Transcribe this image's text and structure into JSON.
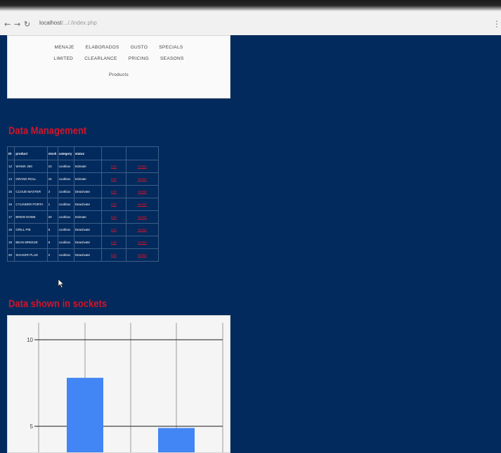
{
  "browser": {
    "back": "←",
    "forward": "→",
    "reload": "↻",
    "url_host": "localhost",
    "url_path": "/..././index.php",
    "menu": "⋮"
  },
  "categories": {
    "row1": [
      "MENAJE",
      "ELABORADOS",
      "GUSTO",
      "SPECIALS"
    ],
    "row2": [
      "LIMITED",
      "CLEARLANCE",
      "PRICING",
      "SEASONS"
    ],
    "row3": [
      "Products"
    ]
  },
  "management": {
    "title": "Data Management",
    "headers": [
      "ID",
      "product",
      "stock",
      "category",
      "status",
      "",
      ""
    ],
    "rows": [
      [
        "12",
        "WHISK 250",
        "10",
        "cookbox",
        "Intimate",
        "Edit",
        "Delete"
      ],
      [
        "14",
        "GRAND ROLL",
        "15",
        "cookbox",
        "Intimate",
        "Edit",
        "Delete"
      ],
      [
        "15",
        "CLOUD MASTER",
        "3",
        "cookbox",
        "Deactivate",
        "Edit",
        "Delete"
      ],
      [
        "16",
        "CYLINDER PORTA",
        "1",
        "cookbox",
        "Deactivate",
        "Edit",
        "Delete"
      ],
      [
        "17",
        "BREW DOME",
        "20",
        "cookbox",
        "Intimate",
        "Edit",
        "Delete"
      ],
      [
        "18",
        "GRILL PIE",
        "5",
        "cookbox",
        "Deactivate",
        "Edit",
        "Delete"
      ],
      [
        "19",
        "BEAN BREEZE",
        "8",
        "cookbox",
        "Deactivate",
        "Edit",
        "Delete"
      ],
      [
        "20",
        "SHAKER PLUS",
        "2",
        "cookbox",
        "Deactivate",
        "Edit",
        "Delete"
      ]
    ]
  },
  "chart_section": {
    "title": "Data shown in sockets"
  },
  "colors": {
    "page_background": "#032a5c",
    "accent_red": "#d4142a",
    "bar_blue": "#4285f4"
  },
  "chart_data": {
    "type": "bar",
    "ylim": [
      0,
      15
    ],
    "yticks": [
      "10",
      "5"
    ],
    "tick_values": [
      10,
      5
    ],
    "values": [
      7.8,
      4.9
    ],
    "grid": true
  }
}
